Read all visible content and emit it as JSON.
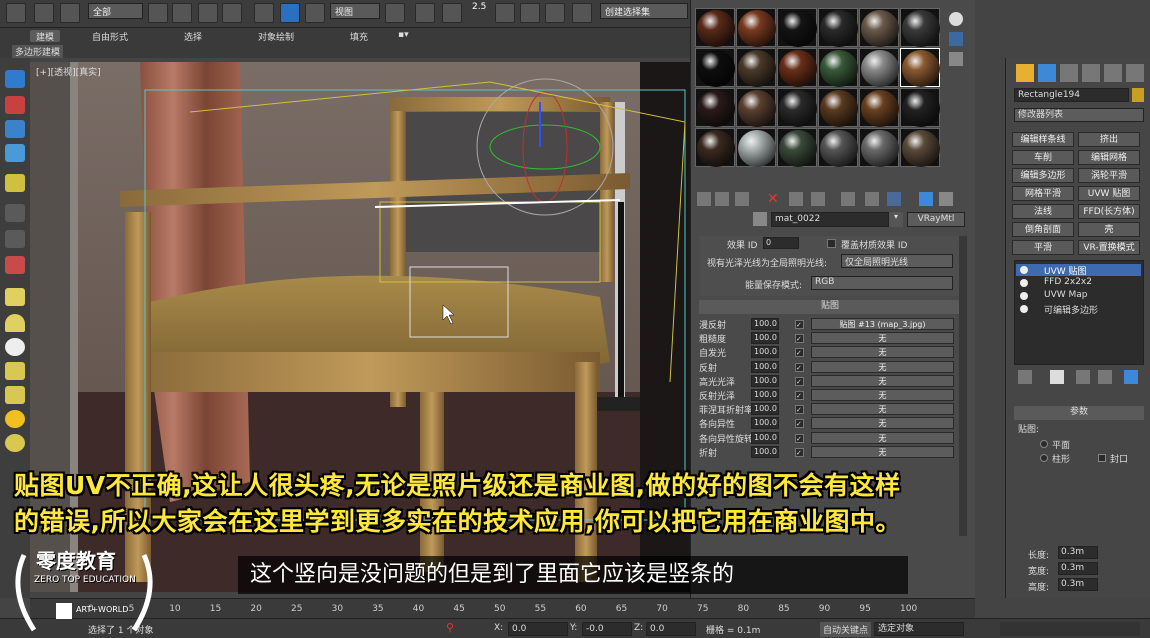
{
  "toolbar": {
    "filter_select": "全部",
    "view_select": "视图",
    "snap_value": "2.5",
    "selection_set": "创建选择集"
  },
  "ribbon": {
    "tabs": [
      "建模",
      "自由形式",
      "选择",
      "对象绘制",
      "填充"
    ],
    "sub_label": "多边形建模"
  },
  "viewport": {
    "label": "[+][透视][真实]"
  },
  "material_editor": {
    "material_name": "mat_0022",
    "material_type": "VRayMtl",
    "effect_id_label": "效果 ID",
    "effect_id_value": "0",
    "override_label": "覆盖材质效果 ID",
    "gi_label": "视有光泽光线为全局照明光线:",
    "gi_value": "仅全局照明光线",
    "energy_label": "能量保存模式:",
    "energy_value": "RGB",
    "maps_header": "贴图",
    "maps": [
      {
        "label": "漫反射",
        "value": "100.0",
        "map": "贴图 #13 (map_3.jpg)"
      },
      {
        "label": "粗糙度",
        "value": "100.0",
        "map": "无"
      },
      {
        "label": "自发光",
        "value": "100.0",
        "map": "无"
      },
      {
        "label": "反射",
        "value": "100.0",
        "map": "无"
      },
      {
        "label": "高光光泽",
        "value": "100.0",
        "map": "无"
      },
      {
        "label": "反射光泽",
        "value": "100.0",
        "map": "无"
      },
      {
        "label": "菲涅耳折射率",
        "value": "100.0",
        "map": "无"
      },
      {
        "label": "各向异性",
        "value": "100.0",
        "map": "无"
      },
      {
        "label": "各向异性旋转",
        "value": "100.0",
        "map": "无"
      },
      {
        "label": "折射",
        "value": "100.0",
        "map": "无"
      }
    ]
  },
  "command_panel": {
    "object_name": "Rectangle194",
    "modifier_list": "修改器列表",
    "modifier_buttons": [
      "编辑样条线",
      "挤出",
      "车削",
      "编辑网格",
      "编辑多边形",
      "涡轮平滑",
      "网格平滑",
      "UVW 贴图",
      "法线",
      "FFD(长方体)",
      "倒角剖面",
      "壳",
      "平滑",
      "VR-置换模式"
    ],
    "stack": [
      {
        "name": "UVW 贴图",
        "selected": true
      },
      {
        "name": "FFD 2x2x2",
        "selected": false
      },
      {
        "name": "UVW Map",
        "selected": false
      },
      {
        "name": "可编辑多边形",
        "selected": false
      }
    ],
    "params_header": "参数",
    "mapping_label": "贴图:",
    "opt_planar": "平面",
    "opt_cylindrical": "柱形",
    "opt_cap": "封口",
    "length_label": "长度:",
    "length_value": "0.3m",
    "width_label": "宽度:",
    "width_value": "0.3m",
    "height_label": "高度:",
    "height_value": "0.3m"
  },
  "timeline": {
    "ticks": [
      "0",
      "5",
      "10",
      "15",
      "20",
      "25",
      "30",
      "35",
      "40",
      "45",
      "50",
      "55",
      "60",
      "65",
      "70",
      "75",
      "80",
      "85",
      "90",
      "95",
      "100"
    ]
  },
  "status": {
    "selected": "选择了 1 个对象",
    "x_label": "X:",
    "x_value": "0.0",
    "y_label": "Y:",
    "y_value": "-0.0",
    "z_label": "Z:",
    "z_value": "0.0",
    "grid": "栅格 = 0.1m",
    "auto_key": "自动关键点",
    "set_key": "选定对象"
  },
  "subtitles": {
    "yellow_line1": "贴图UV不正确,这让人很头疼,无论是照片级还是商业图,做的好的图不会有这样",
    "yellow_line2": "的错误,所以大家会在这里学到更多实在的技术应用,你可以把它用在商业图中。",
    "white": "这个竖向是没问题的但是到了里面它应该是竖条的"
  },
  "logo": {
    "title": "零度教育",
    "subtitle": "ZERO TOP EDUCATION",
    "badge": "ART+WORLD"
  },
  "colors": {
    "subtitle_yellow": "#ffe83a",
    "selection_blue": "#3e6ab0"
  }
}
